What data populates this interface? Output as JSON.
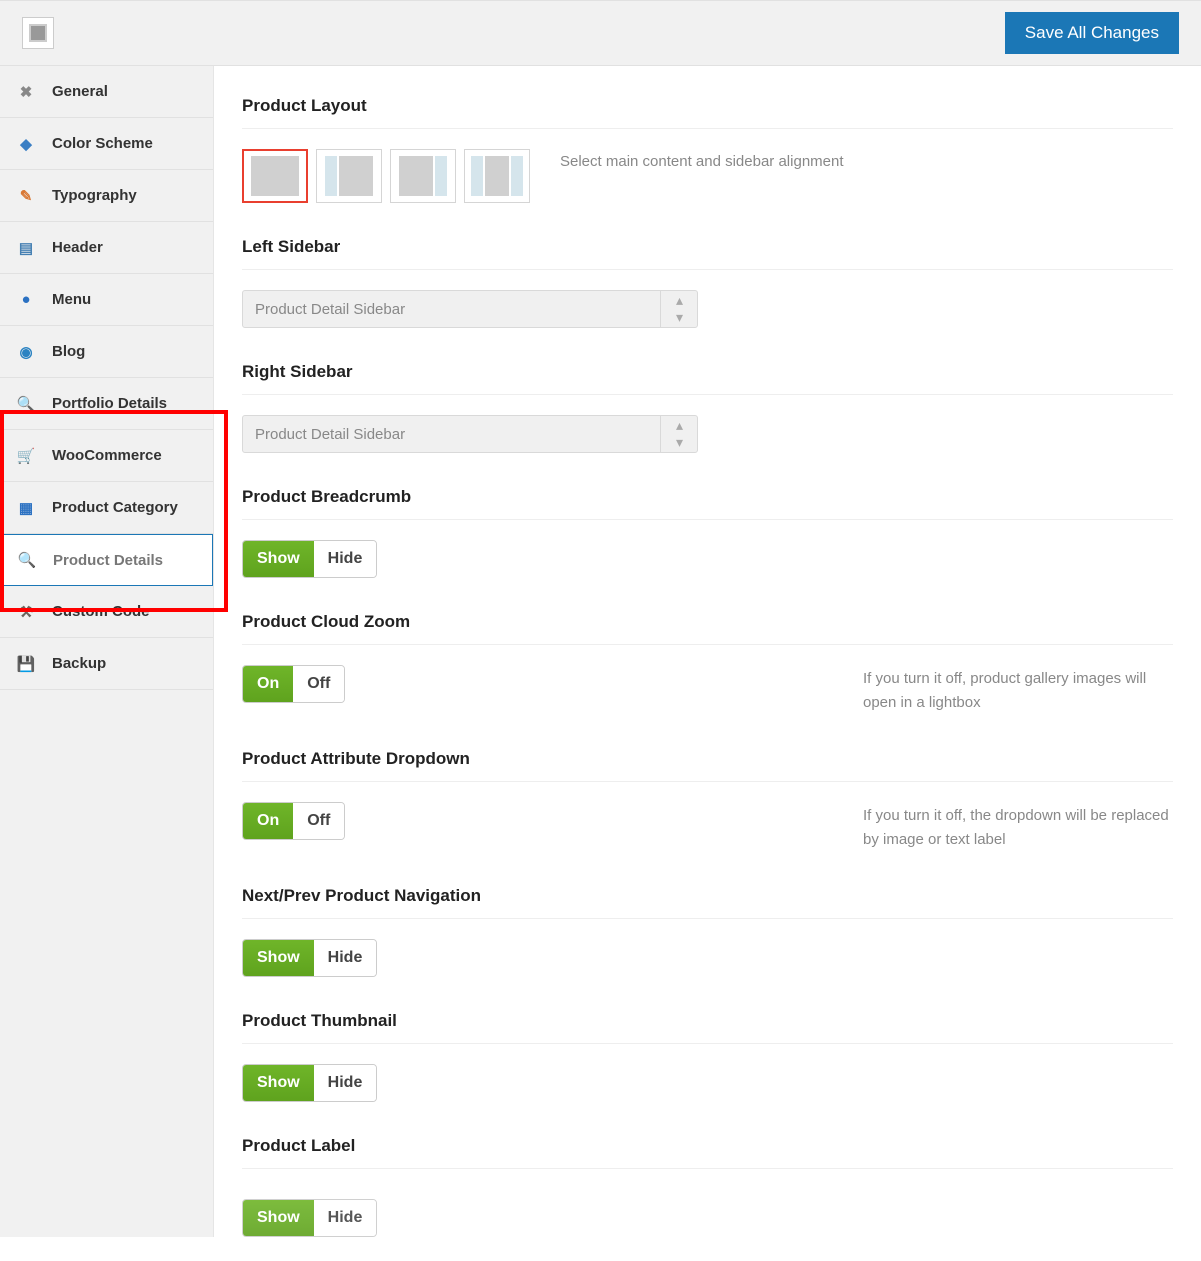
{
  "header": {
    "save_label": "Save All Changes"
  },
  "sidebar": {
    "items": [
      {
        "label": "General",
        "icon": "wrench-icon"
      },
      {
        "label": "Color Scheme",
        "icon": "palette-icon"
      },
      {
        "label": "Typography",
        "icon": "font-icon"
      },
      {
        "label": "Header",
        "icon": "header-icon"
      },
      {
        "label": "Menu",
        "icon": "menu-icon"
      },
      {
        "label": "Blog",
        "icon": "blog-icon"
      },
      {
        "label": "Portfolio Details",
        "icon": "search-icon"
      },
      {
        "label": "WooCommerce",
        "icon": "cart-icon"
      },
      {
        "label": "Product Category",
        "icon": "list-icon"
      },
      {
        "label": "Product Details",
        "icon": "search-icon"
      },
      {
        "label": "Custom Code",
        "icon": "tools-icon"
      },
      {
        "label": "Backup",
        "icon": "backup-icon"
      }
    ],
    "active_index": 9
  },
  "sections": {
    "product_layout": {
      "title": "Product Layout",
      "description": "Select main content and sidebar alignment",
      "selected": 0
    },
    "left_sidebar": {
      "title": "Left Sidebar",
      "value": "Product Detail Sidebar"
    },
    "right_sidebar": {
      "title": "Right Sidebar",
      "value": "Product Detail Sidebar"
    },
    "breadcrumb": {
      "title": "Product Breadcrumb",
      "on_label": "Show",
      "off_label": "Hide",
      "value": "on"
    },
    "cloud_zoom": {
      "title": "Product Cloud Zoom",
      "on_label": "On",
      "off_label": "Off",
      "value": "on",
      "description": "If you turn it off, product gallery images will open in a lightbox"
    },
    "attribute_dropdown": {
      "title": "Product Attribute Dropdown",
      "on_label": "On",
      "off_label": "Off",
      "value": "on",
      "description": "If you turn it off, the dropdown will be replaced by image or text label"
    },
    "next_prev": {
      "title": "Next/Prev Product Navigation",
      "on_label": "Show",
      "off_label": "Hide",
      "value": "on"
    },
    "thumbnail": {
      "title": "Product Thumbnail",
      "on_label": "Show",
      "off_label": "Hide",
      "value": "on"
    },
    "label": {
      "title": "Product Label",
      "on_label": "Show",
      "off_label": "Hide",
      "value": "on"
    }
  }
}
